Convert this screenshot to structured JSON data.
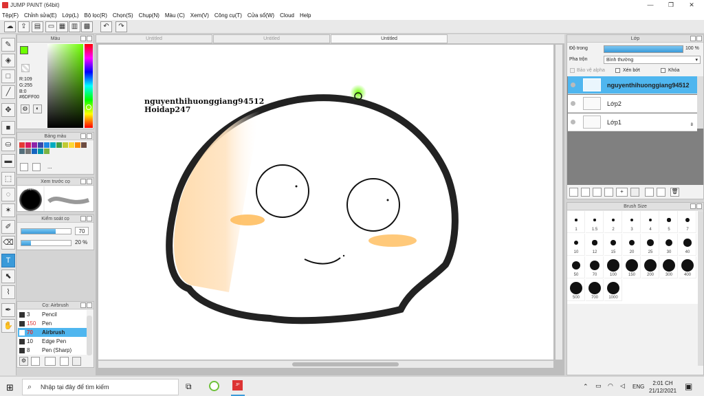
{
  "window": {
    "title": "JUMP PAINT (64bit)",
    "minimize": "—",
    "maximize": "❐",
    "close": "✕"
  },
  "menu": [
    "Tệp(F)",
    "Chỉnh sửa(E)",
    "Lớp(L)",
    "Bộ lọc(R)",
    "Chọn(S)",
    "Chụp(N)",
    "Màu (C)",
    "Xem(V)",
    "Công cụ(T)",
    "Cửa sổ(W)",
    "Cloud",
    "Help"
  ],
  "doc_tabs": [
    "Untitled",
    "Untitled",
    "Untitled"
  ],
  "color_panel": {
    "title": "Màu",
    "r": "R:109",
    "g": "G:255",
    "b": "B:0",
    "hex": "#6DFF00",
    "fg_color": "#6dff00",
    "bg_color": "#ff9900"
  },
  "palette_panel": {
    "title": "Bảng màu",
    "more": "...",
    "swatches": [
      "#e53935",
      "#d81b60",
      "#8e24aa",
      "#3949ab",
      "#1e88e5",
      "#00acc1",
      "#43a047",
      "#c0ca33",
      "#fdd835",
      "#fb8c00",
      "#6d4c41",
      "#546e7a",
      "#757575",
      "#1565c0",
      "#0097a7",
      "#7cb342"
    ]
  },
  "preview_panel": {
    "title": "Xem trước cọ",
    "size_label": "70.0(mm)"
  },
  "brush_control": {
    "title": "Kiểm soát cọ",
    "size": "70",
    "opacity": "20 %",
    "size_fraction": 0.7,
    "opacity_fraction": 0.2
  },
  "brush_list": {
    "title": "Cọ: Airbrush",
    "items": [
      {
        "size": "3",
        "name": "Pencil"
      },
      {
        "size": "150",
        "name": "Pen"
      },
      {
        "size": "70",
        "name": "Airbrush"
      },
      {
        "size": "10",
        "name": "Edge Pen"
      },
      {
        "size": "8",
        "name": "Pen (Sharp)"
      }
    ]
  },
  "canvas_text": {
    "line1": "nguyenthihuonggiang94512",
    "line2": "Hoidap247"
  },
  "layer_panel": {
    "title": "Lớp",
    "opacity_label": "Độ trong",
    "opacity_value": "100 %",
    "opacity_fraction": 1.0,
    "blend_label": "Pha trộn",
    "blend_value": "Bình thường",
    "protect_alpha": "Bảo vệ alpha",
    "clipping": "Xén bớt",
    "lock": "Khóa",
    "layers": [
      {
        "name": "nguyenthihuonggiang94512",
        "selected": true
      },
      {
        "name": "Lớp2",
        "selected": false
      },
      {
        "name": "Lớp1",
        "selected": false,
        "badge": "8"
      }
    ]
  },
  "brush_size_panel": {
    "title": "Brush Size",
    "sizes": [
      "1",
      "1.5",
      "2",
      "3",
      "4",
      "5",
      "7",
      "10",
      "12",
      "15",
      "20",
      "25",
      "30",
      "40",
      "50",
      "70",
      "100",
      "150",
      "200",
      "300",
      "400",
      "500",
      "700",
      "1000"
    ]
  },
  "taskbar": {
    "search_placeholder": "Nhập tại đây để tìm kiếm",
    "lang": "ENG",
    "time": "2:01 CH",
    "date": "21/12/2021"
  }
}
